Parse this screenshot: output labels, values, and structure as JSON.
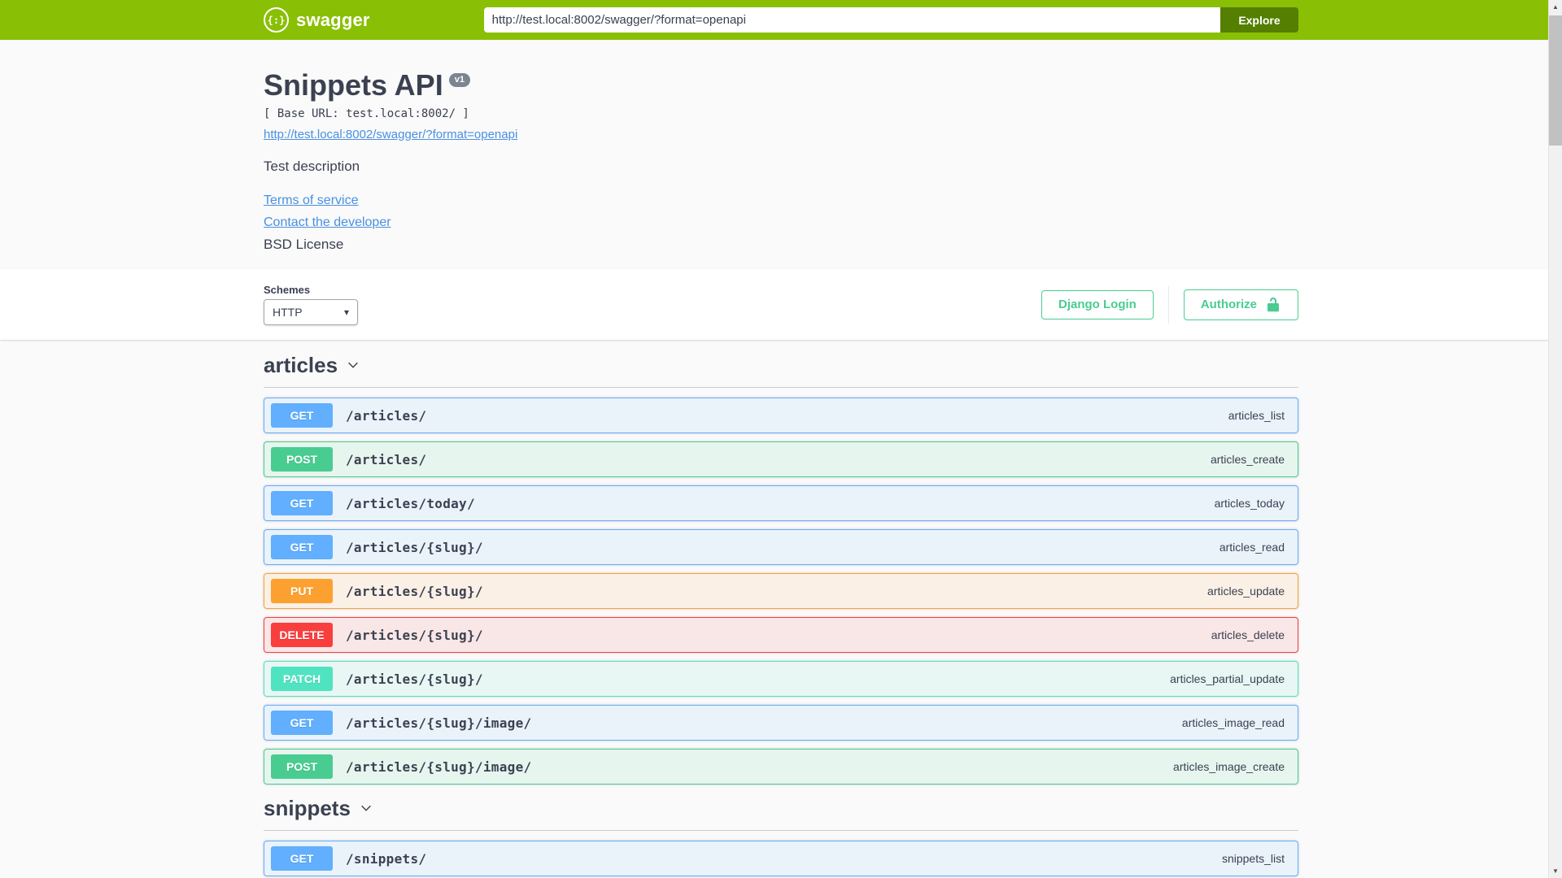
{
  "topbar": {
    "brand": "swagger",
    "url_value": "http://test.local:8002/swagger/?format=openapi",
    "explore_label": "Explore"
  },
  "info": {
    "title": "Snippets API",
    "version_badge": "v1",
    "base_url_line": "[ Base URL: test.local:8002/ ]",
    "spec_link": "http://test.local:8002/swagger/?format=openapi",
    "description": "Test description",
    "terms_label": "Terms of service",
    "contact_label": "Contact the developer",
    "license": "BSD License"
  },
  "schemes": {
    "label": "Schemes",
    "selected": "HTTP"
  },
  "auth": {
    "django_login_label": "Django Login",
    "authorize_label": "Authorize"
  },
  "icons": {
    "swagger_logo_glyph": "{:}",
    "select_chevron": "▾",
    "scroll_up": "▲",
    "scroll_down": "▼"
  },
  "colors": {
    "topbar_bg": "#89bf04",
    "explore_button_bg": "#547f00",
    "get": "#61affe",
    "post": "#49cc90",
    "put": "#fca130",
    "delete": "#f93e3e",
    "patch": "#50e3c2",
    "auth_green": "#49cc90",
    "link_blue": "#4990e2",
    "text": "#3b4151",
    "version_badge_bg": "#7d8492"
  },
  "sections": [
    {
      "tag": "articles",
      "operations": [
        {
          "method": "GET",
          "path": "/articles/",
          "operation_id": "articles_list"
        },
        {
          "method": "POST",
          "path": "/articles/",
          "operation_id": "articles_create"
        },
        {
          "method": "GET",
          "path": "/articles/today/",
          "operation_id": "articles_today"
        },
        {
          "method": "GET",
          "path": "/articles/{slug}/",
          "operation_id": "articles_read"
        },
        {
          "method": "PUT",
          "path": "/articles/{slug}/",
          "operation_id": "articles_update"
        },
        {
          "method": "DELETE",
          "path": "/articles/{slug}/",
          "operation_id": "articles_delete"
        },
        {
          "method": "PATCH",
          "path": "/articles/{slug}/",
          "operation_id": "articles_partial_update"
        },
        {
          "method": "GET",
          "path": "/articles/{slug}/image/",
          "operation_id": "articles_image_read"
        },
        {
          "method": "POST",
          "path": "/articles/{slug}/image/",
          "operation_id": "articles_image_create"
        }
      ]
    },
    {
      "tag": "snippets",
      "operations": [
        {
          "method": "GET",
          "path": "/snippets/",
          "operation_id": "snippets_list"
        }
      ]
    }
  ]
}
